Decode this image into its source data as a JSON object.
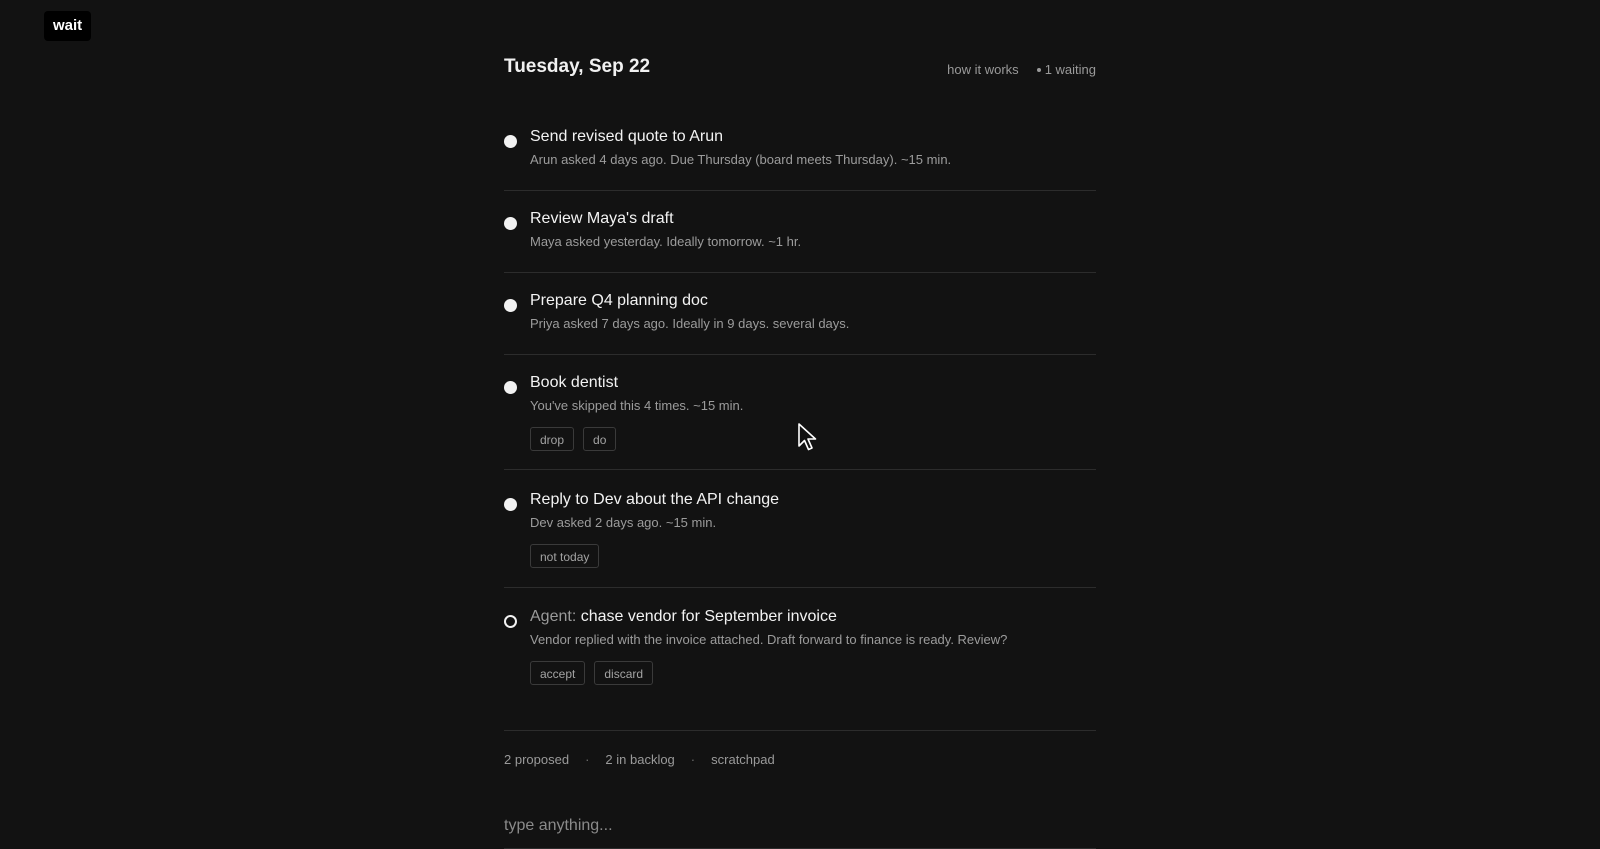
{
  "app": {
    "logo": "wait"
  },
  "header": {
    "date": "Tuesday, Sep 22",
    "how_it_works": "how it works",
    "waiting": "1 waiting"
  },
  "tasks": [
    {
      "title": "Send revised quote to Arun",
      "subtitle": "Arun asked 4 days ago. Due Thursday (board meets Thursday). ~15 min.",
      "bullet": "filled",
      "actions": []
    },
    {
      "title": "Review Maya's draft",
      "subtitle": "Maya asked yesterday. Ideally tomorrow. ~1 hr.",
      "bullet": "filled",
      "actions": []
    },
    {
      "title": "Prepare Q4 planning doc",
      "subtitle": "Priya asked 7 days ago. Ideally in 9 days. several days.",
      "bullet": "filled",
      "actions": []
    },
    {
      "title": "Book dentist",
      "subtitle": "You've skipped this 4 times. ~15 min.",
      "bullet": "filled",
      "actions": [
        "drop",
        "do"
      ]
    },
    {
      "title": "Reply to Dev about the API change",
      "subtitle": "Dev asked 2 days ago. ~15 min.",
      "bullet": "filled",
      "actions": [
        "not today"
      ]
    },
    {
      "prefix": "Agent:",
      "title": "chase vendor for September invoice",
      "subtitle": "Vendor replied with the invoice attached. Draft forward to finance is ready. Review?",
      "bullet": "hollow",
      "actions": [
        "accept",
        "discard"
      ]
    }
  ],
  "footer": {
    "proposed": "2 proposed",
    "separator": "·",
    "backlog": "2 in backlog",
    "scratchpad": "scratchpad"
  },
  "input": {
    "placeholder": "type anything..."
  },
  "icons": {
    "cursor": "mouse-pointer-icon"
  },
  "colors": {
    "background": "#121212",
    "text": "#f3f3f3",
    "muted": "#9c9c9c",
    "divider": "#2c2c2c"
  }
}
